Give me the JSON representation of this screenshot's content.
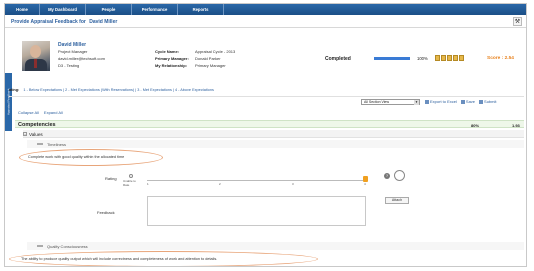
{
  "nav": {
    "tabs": [
      "Home",
      "My Dashboard",
      "People",
      "Performance",
      "Reports"
    ]
  },
  "header": {
    "title": "Provide Appraisal Feedback for",
    "employee": "David Miller"
  },
  "profile": {
    "name": "David Miller",
    "designation": "Project Manager",
    "email": "david.miller@techsoft.com",
    "department": "D3 - Testing"
  },
  "cycle": {
    "cycle_label": "Cycle Name:",
    "cycle_value": "Appraisal Cycle - 2013",
    "primary_label": "Primary Manager:",
    "primary_value": "Donald Parker",
    "relationship_label": "My Relationship:",
    "relationship_value": "Primary Manager"
  },
  "status": {
    "completed_label": "Completed",
    "percent": "100%",
    "progress_fraction": 1.0,
    "score": "Score : 2.54"
  },
  "side_tab": "Appraisal Feedback",
  "rating_legend": {
    "label": "ating:",
    "items": [
      "1 - Below Expectations",
      "2 - Met Expectations (With Reservations)",
      "3 - Met Expectations",
      "4 - Above Expectations"
    ]
  },
  "toolbar": {
    "section_view": "All Section View",
    "export": "Export to Excel",
    "save": "Save",
    "submit": "Submit"
  },
  "expand": {
    "collapse_all": "Collapse All",
    "expand_all": "Expand All"
  },
  "competencies": {
    "label": "Competencies",
    "percent": "80%",
    "score": "1.93"
  },
  "values": {
    "label": "Values"
  },
  "timeliness": {
    "label": "Timeliness",
    "description": "Complete work with good quality within the allocated time"
  },
  "rating_widget": {
    "label": "Rating",
    "unable_to_rate": [
      "Unable to",
      "Rate"
    ],
    "ticks": [
      "1",
      "2",
      "3",
      "4"
    ]
  },
  "feedback": {
    "label": "Feedback",
    "attach": "Attach"
  },
  "quality": {
    "label": "Quality Consciousness",
    "description": "The ability to produce quality output which will include correctness and completeness of work and attention to details."
  }
}
